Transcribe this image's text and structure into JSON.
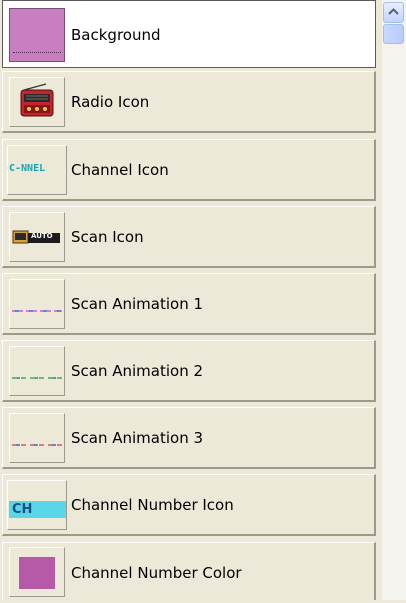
{
  "items": [
    {
      "label": "Background",
      "icon": "background-swatch-icon",
      "selected": true
    },
    {
      "label": "Radio Icon",
      "icon": "radio-icon"
    },
    {
      "label": "Channel Icon",
      "icon": "channel-icon",
      "icon_text": "C-NNEL"
    },
    {
      "label": "Scan Icon",
      "icon": "scan-icon",
      "icon_text": "AUTO"
    },
    {
      "label": "Scan Animation 1",
      "icon": "scan-animation-1-icon"
    },
    {
      "label": "Scan Animation 2",
      "icon": "scan-animation-2-icon"
    },
    {
      "label": "Scan Animation 3",
      "icon": "scan-animation-3-icon"
    },
    {
      "label": "Channel Number Icon",
      "icon": "channel-number-icon",
      "icon_text": "CH"
    },
    {
      "label": "Channel Number Color",
      "icon": "channel-number-color-swatch-icon"
    }
  ],
  "colors": {
    "background_swatch": "#c87fbf",
    "channel_number_color": "#b65aa8",
    "channel_number_icon_bg": "#5ad7e6",
    "window_bg": "#ece9d8"
  }
}
